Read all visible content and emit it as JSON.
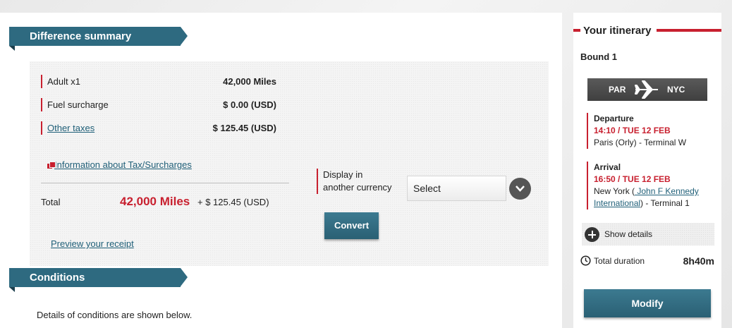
{
  "difference_summary": {
    "title": "Difference summary",
    "items": [
      {
        "label": "Adult x1",
        "value": "42,000 Miles"
      },
      {
        "label": "Fuel surcharge",
        "value": "$ 0.00 (USD)"
      },
      {
        "label": "Other taxes",
        "value": "$ 125.45 (USD)"
      }
    ],
    "info_link": "Information about Tax/Surcharges",
    "total_label": "Total",
    "total_miles": "42,000 Miles",
    "total_extra": "+ $ 125.45 (USD)",
    "receipt_link": "Preview your receipt",
    "currency": {
      "label_line1": "Display in",
      "label_line2": "another currency",
      "selected": "Select",
      "convert_label": "Convert"
    }
  },
  "conditions": {
    "title": "Conditions",
    "text": "Details of conditions are shown below."
  },
  "itinerary": {
    "title": "Your itinerary",
    "bound": "Bound 1",
    "from": "PAR",
    "to": "NYC",
    "departure": {
      "heading": "Departure",
      "time": "14:10 / TUE 12 FEB",
      "place": "Paris (Orly) - Terminal  W"
    },
    "arrival": {
      "heading": "Arrival",
      "time": "16:50 / TUE 12 FEB",
      "place_prefix": "New York (",
      "airport_link_1": " John F Kennedy",
      "airport_link_2": "International",
      "place_suffix": ") - Terminal  1"
    },
    "show_details": "Show details",
    "duration_label": "Total duration",
    "duration_value": "8h40m",
    "modify_label": "Modify"
  },
  "colors": {
    "accent_red": "#c8202f",
    "ribbon_teal": "#2e6a80",
    "link_blue": "#1f5f78"
  },
  "icons": [
    "chevron-down-icon",
    "plane-icon",
    "plus-circle-icon",
    "clock-icon",
    "document-icon"
  ]
}
